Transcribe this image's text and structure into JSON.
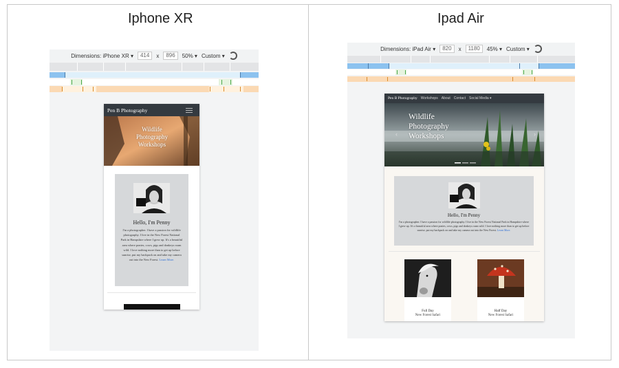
{
  "panels": {
    "left_title": "Iphone XR",
    "right_title": "Ipad Air"
  },
  "devtools_left": {
    "dimensions_label": "Dimensions: iPhone XR ▾",
    "width": "414",
    "times": "x",
    "height": "896",
    "zoom": "50% ▾",
    "throttle": "Custom ▾"
  },
  "devtools_right": {
    "dimensions_label": "Dimensions: iPad Air ▾",
    "width": "820",
    "times": "x",
    "height": "1180",
    "zoom": "45% ▾",
    "throttle": "Custom ▾"
  },
  "site": {
    "brand": "Pen B Photography",
    "nav_links": [
      "Workshops",
      "About",
      "Contact",
      "Social Media ▾"
    ],
    "hero_line1": "Wildlife",
    "hero_line2": "Photography",
    "hero_line3": "Workshops",
    "hello": "Hello, I'm Penny",
    "bio_phone": "I'm a photographer. I have a passion for wildlife photography. I live in the New Forest National Park in Hampshire where I grew up. It's a beautiful area where ponies, cows, pigs and donkeys roam wild. I love nothing more than to get up before sunrise, put my backpack on and take my camera out into the New Forest.",
    "bio_tablet": "I'm a photographer. I have a passion for wildlife photography. I live in the New Forest National Park in Hampshire where I grew up. It's a beautiful area where ponies, cows, pigs and donkeys roam wild. I love nothing more than to get up before sunrise, put my backpack on and take my camera out into the New Forest.",
    "learn_more": "Learn More.",
    "cards": [
      {
        "title": "Full Day",
        "subtitle": "New Forest Safari"
      },
      {
        "title": "Half Day",
        "subtitle": "New Forest Safari"
      }
    ]
  },
  "colors": {
    "navbar": "#343a40",
    "about_bg": "#d6d8da",
    "link": "#2d6fd6"
  }
}
